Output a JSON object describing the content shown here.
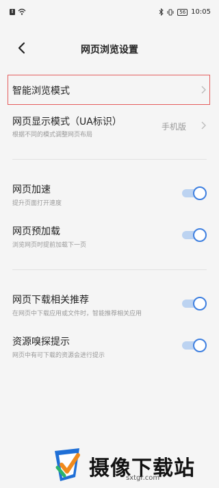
{
  "status_bar": {
    "time": "10:05",
    "battery": "56"
  },
  "header": {
    "title": "网页浏览设置"
  },
  "settings": {
    "smart_mode": {
      "title": "智能浏览模式"
    },
    "display_mode": {
      "title": "网页显示模式（UA标识）",
      "subtitle": "根据不同的模式调整网页布局",
      "value": "手机版"
    },
    "acceleration": {
      "title": "网页加速",
      "subtitle": "提升页面打开速度",
      "on": true
    },
    "preload": {
      "title": "网页预加载",
      "subtitle": "浏览网页时提前加载下一页",
      "on": true
    },
    "download_recommend": {
      "title": "网页下载相关推荐",
      "subtitle": "在网页中下载应用或文件时，智能推荐相关应用",
      "on": true
    },
    "resource_sniff": {
      "title": "资源嗅探提示",
      "subtitle": "网页中有可下载的资源会进行提示",
      "on": true
    }
  },
  "watermark": {
    "name": "摄像下载站",
    "url": "sxtgr.com"
  },
  "colors": {
    "accent": "#3d7fe0",
    "highlight_border": "#e45c5c",
    "track": "#bcd3f1"
  }
}
